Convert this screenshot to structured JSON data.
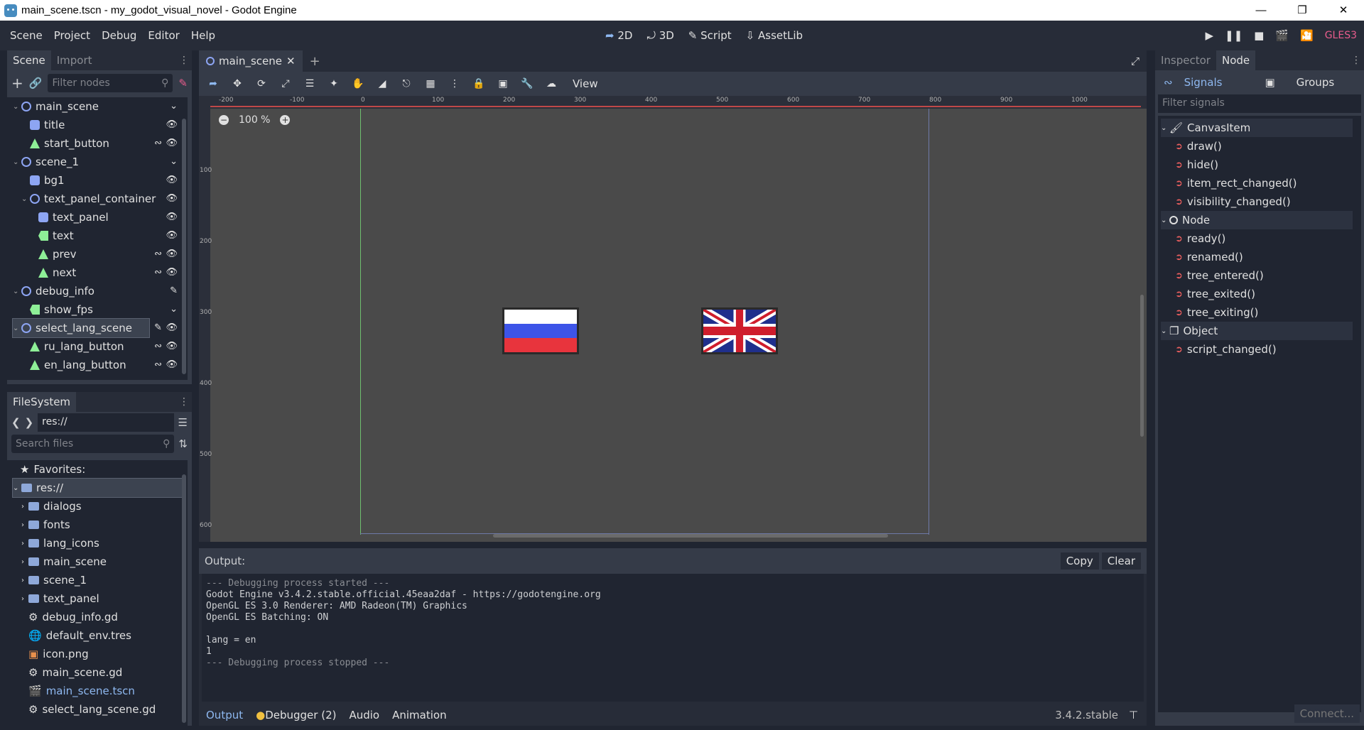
{
  "window": {
    "title": "main_scene.tscn - my_godot_visual_novel - Godot Engine"
  },
  "menu": {
    "items": [
      "Scene",
      "Project",
      "Debug",
      "Editor",
      "Help"
    ]
  },
  "modes": {
    "m2d": "2D",
    "m3d": "3D",
    "script": "Script",
    "assetlib": "AssetLib"
  },
  "renderer": "GLES3",
  "scene_dock": {
    "tabs": [
      "Scene",
      "Import"
    ],
    "filter_placeholder": "Filter nodes",
    "nodes": [
      "main_scene",
      "title",
      "start_button",
      "scene_1",
      "bg1",
      "text_panel_container",
      "text_panel",
      "text",
      "prev",
      "next",
      "debug_info",
      "show_fps",
      "select_lang_scene",
      "ru_lang_button",
      "en_lang_button"
    ]
  },
  "filesystem": {
    "tab": "FileSystem",
    "path": "res://",
    "search_placeholder": "Search files",
    "favorites": "Favorites:",
    "root": "res://",
    "items": [
      "dialogs",
      "fonts",
      "lang_icons",
      "main_scene",
      "scene_1",
      "text_panel",
      "debug_info.gd",
      "default_env.tres",
      "icon.png",
      "main_scene.gd",
      "main_scene.tscn",
      "select_lang_scene.gd"
    ]
  },
  "viewport": {
    "tab": "main_scene",
    "zoom": "100 %",
    "view_menu": "View",
    "ruler_h": [
      "-200",
      "-100",
      "0",
      "100",
      "200",
      "300",
      "400",
      "500",
      "600",
      "700",
      "800",
      "900",
      "1000"
    ],
    "ruler_v": [
      "100",
      "200",
      "300",
      "400",
      "500",
      "600"
    ]
  },
  "output": {
    "label": "Output:",
    "copy": "Copy",
    "clear": "Clear",
    "lines": [
      "--- Debugging process started ---",
      "Godot Engine v3.4.2.stable.official.45eaa2daf - https://godotengine.org",
      "OpenGL ES 3.0 Renderer: AMD Radeon(TM) Graphics",
      "OpenGL ES Batching: ON",
      "",
      "lang = en",
      "1",
      "--- Debugging process stopped ---"
    ],
    "tabs": [
      "Output",
      "Debugger (2)",
      "Audio",
      "Animation"
    ],
    "version": "3.4.2.stable"
  },
  "inspector": {
    "tabs": [
      "Inspector",
      "Node"
    ],
    "signals_tab": "Signals",
    "groups_tab": "Groups",
    "filter_placeholder": "Filter signals",
    "classes": [
      "CanvasItem",
      "Node",
      "Object"
    ],
    "signals": [
      "draw()",
      "hide()",
      "item_rect_changed()",
      "visibility_changed()",
      "ready()",
      "renamed()",
      "tree_entered()",
      "tree_exited()",
      "tree_exiting()",
      "script_changed()"
    ],
    "connect": "Connect..."
  }
}
